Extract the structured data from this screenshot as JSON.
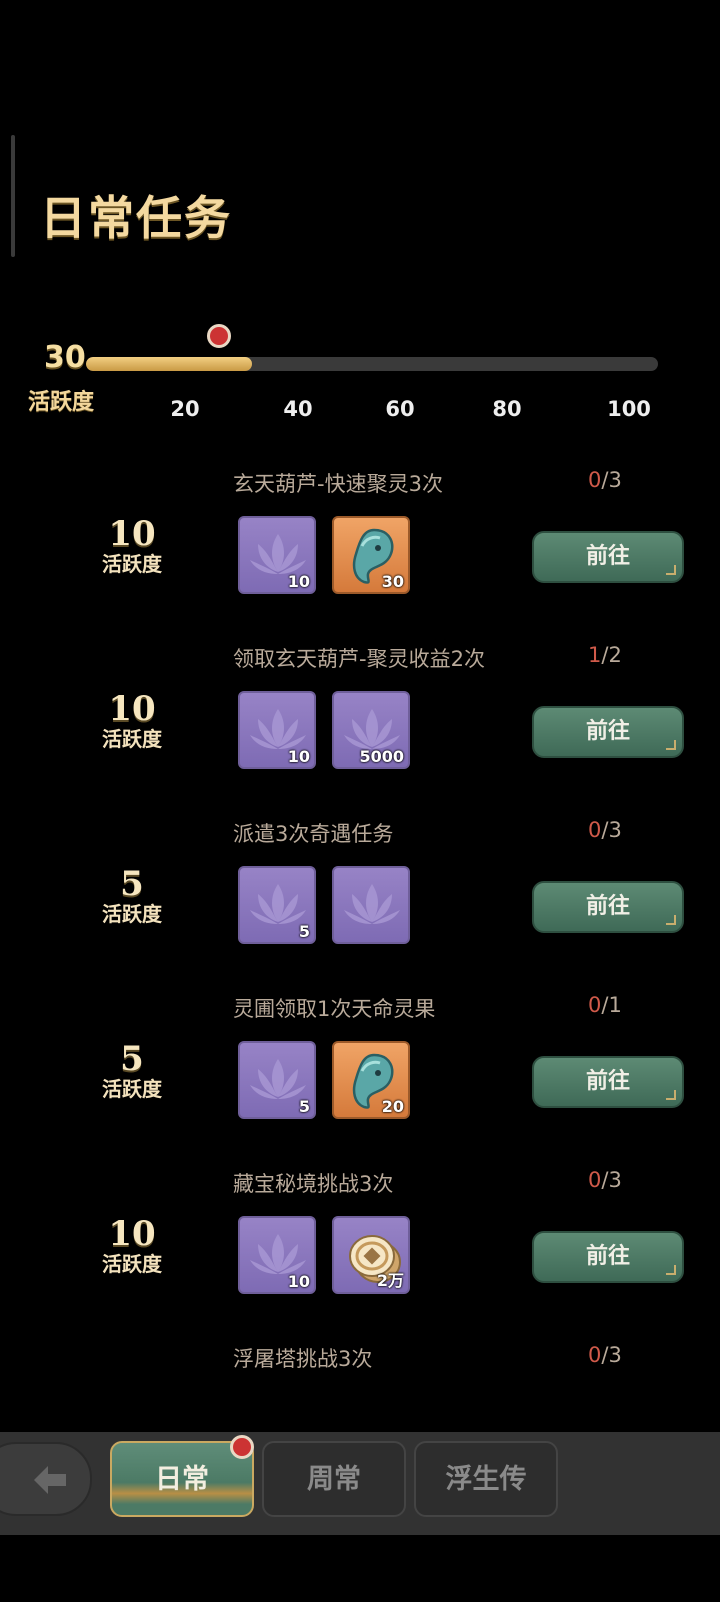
{
  "header": {
    "title": "日常任务"
  },
  "progress": {
    "current": "30",
    "caption": "活跃度",
    "value": 30,
    "max": 100,
    "ticks": [
      "20",
      "40",
      "60",
      "80",
      "100"
    ]
  },
  "tasks": [
    {
      "name": "玄天葫芦-快速聚灵3次",
      "done": "0",
      "total": "/3",
      "points": "10",
      "points_label": "活跃度",
      "rewards": [
        {
          "kind": "lotus",
          "color": "purple",
          "qty": "10"
        },
        {
          "kind": "spirit",
          "color": "orange",
          "qty": "30"
        }
      ],
      "button": "前往"
    },
    {
      "name": "领取玄天葫芦-聚灵收益2次",
      "done": "1",
      "total": "/2",
      "points": "10",
      "points_label": "活跃度",
      "rewards": [
        {
          "kind": "lotus",
          "color": "purple",
          "qty": "10"
        },
        {
          "kind": "lotus",
          "color": "purple",
          "qty": "5000"
        }
      ],
      "button": "前往"
    },
    {
      "name": "派遣3次奇遇任务",
      "done": "0",
      "total": "/3",
      "points": "5",
      "points_label": "活跃度",
      "rewards": [
        {
          "kind": "lotus",
          "color": "purple",
          "qty": "5"
        },
        {
          "kind": "lotus",
          "color": "purple",
          "qty": ""
        }
      ],
      "button": "前往"
    },
    {
      "name": "灵圃领取1次天命灵果",
      "done": "0",
      "total": "/1",
      "points": "5",
      "points_label": "活跃度",
      "rewards": [
        {
          "kind": "lotus",
          "color": "purple",
          "qty": "5"
        },
        {
          "kind": "spirit",
          "color": "orange",
          "qty": "20"
        }
      ],
      "button": "前往"
    },
    {
      "name": "藏宝秘境挑战3次",
      "done": "0",
      "total": "/3",
      "points": "10",
      "points_label": "活跃度",
      "rewards": [
        {
          "kind": "lotus",
          "color": "purple",
          "qty": "10"
        },
        {
          "kind": "coin",
          "color": "purple",
          "qty": "2万"
        }
      ],
      "button": "前往"
    },
    {
      "name": "浮屠塔挑战3次",
      "done": "0",
      "total": "/3",
      "points": "",
      "points_label": "",
      "rewards": [],
      "button": ""
    }
  ],
  "bottom_nav": {
    "back_icon": "arrow-left-icon",
    "tabs": [
      {
        "label": "日常",
        "active": true
      },
      {
        "label": "周常",
        "active": false
      },
      {
        "label": "浮生传",
        "active": false
      }
    ]
  },
  "colors": {
    "accent": "#f4d9a0",
    "button": "#4f7c68",
    "count_highlight": "#d05a4a"
  }
}
